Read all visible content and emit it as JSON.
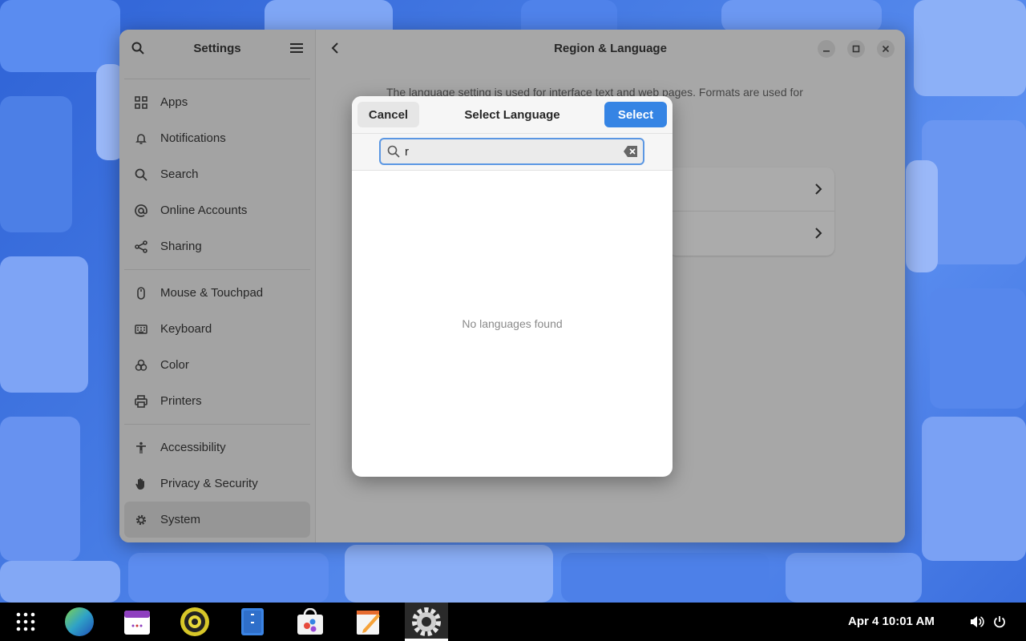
{
  "colors": {
    "accent": "#3584e4",
    "wallpaper": "#3a6fd8",
    "taskbar": "#000000"
  },
  "settings": {
    "title": "Settings",
    "search_icon": "search-icon",
    "menu_icon": "hamburger-menu-icon",
    "sidebar": {
      "groups": [
        [
          {
            "label": "Apps",
            "icon": "apps-grid-icon"
          },
          {
            "label": "Notifications",
            "icon": "bell-icon"
          },
          {
            "label": "Search",
            "icon": "search-icon"
          },
          {
            "label": "Online Accounts",
            "icon": "at-sign-icon"
          },
          {
            "label": "Sharing",
            "icon": "share-icon"
          }
        ],
        [
          {
            "label": "Mouse & Touchpad",
            "icon": "mouse-icon"
          },
          {
            "label": "Keyboard",
            "icon": "keyboard-icon"
          },
          {
            "label": "Color",
            "icon": "color-icon"
          },
          {
            "label": "Printers",
            "icon": "printer-icon"
          }
        ],
        [
          {
            "label": "Accessibility",
            "icon": "accessibility-icon"
          },
          {
            "label": "Privacy & Security",
            "icon": "hand-icon"
          },
          {
            "label": "System",
            "icon": "gear-icon",
            "active": true
          }
        ]
      ]
    },
    "page": {
      "title": "Region & Language",
      "description": "The language setting is used for interface text and web pages. Formats are used for"
    }
  },
  "dialog": {
    "cancel_label": "Cancel",
    "title": "Select Language",
    "select_label": "Select",
    "search_value": "r",
    "empty_text": "No languages found"
  },
  "taskbar": {
    "apps": [
      "app-grid-icon",
      "browser-globe-icon",
      "calendar-icon",
      "music-player-icon",
      "file-manager-icon",
      "software-store-icon",
      "text-editor-icon",
      "settings-gear-icon"
    ],
    "clock": "Apr 4  10:01 AM"
  }
}
